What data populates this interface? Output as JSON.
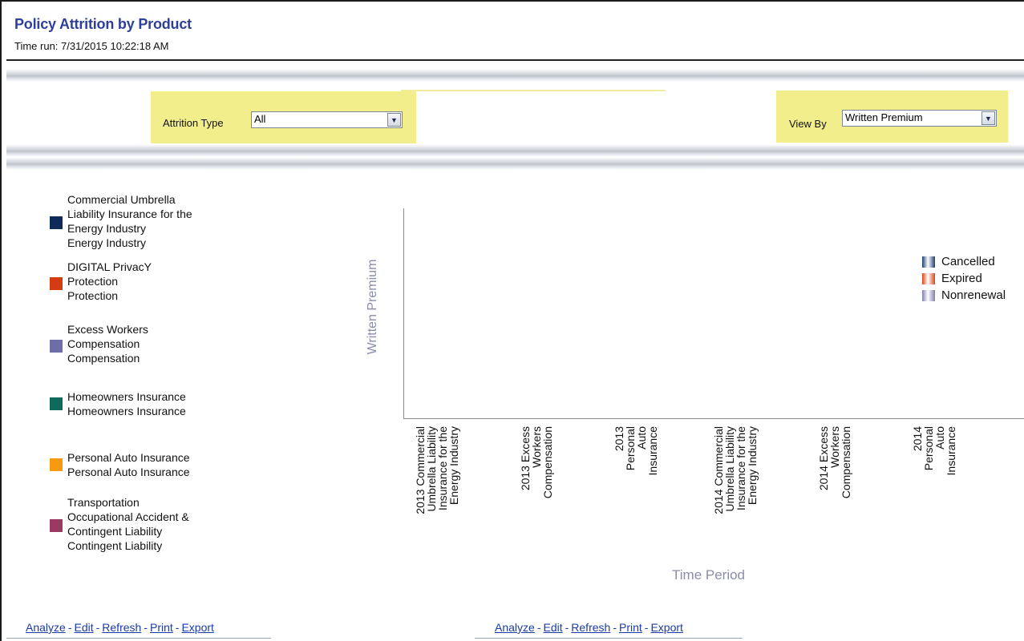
{
  "report": {
    "title": "Policy Attrition by Product",
    "time_run": "Time run: 7/31/2015 10:22:18 AM"
  },
  "prompts": {
    "attrition_type": {
      "label": "Attrition Type",
      "value": "All"
    },
    "view_by": {
      "label": "View By",
      "value": "Written Premium"
    }
  },
  "product_legend": [
    {
      "label_lines": [
        "Commercial Umbrella",
        "Liability Insurance for the",
        "Energy Industry",
        "Energy Industry"
      ],
      "color": "#0f2a5a"
    },
    {
      "label_lines": [
        "DIGITAL PrivacY",
        "Protection",
        "Protection"
      ],
      "color": "#d23c10"
    },
    {
      "label_lines": [
        "Excess Workers",
        "Compensation",
        "Compensation"
      ],
      "color": "#6e6ea6"
    },
    {
      "label_lines": [
        "Homeowners Insurance",
        "Homeowners Insurance"
      ],
      "color": "#0e6b5b"
    },
    {
      "label_lines": [
        "Personal Auto Insurance",
        "Personal Auto Insurance"
      ],
      "color": "#f79a10"
    },
    {
      "label_lines": [
        "Transportation",
        "Occupational Accident &",
        "Contingent Liability",
        "Contingent Liability"
      ],
      "color": "#9a3a62"
    }
  ],
  "chart_data": {
    "type": "bar",
    "xlabel": "Time Period",
    "ylabel": "Written Premium",
    "categories": [
      [
        "2013 Commercial",
        "Umbrella Liability",
        "Insurance for the",
        "Energy Industry"
      ],
      [
        "2013 Excess",
        "Workers",
        "Compensation"
      ],
      [
        "2013",
        "Personal",
        "Auto",
        "Insurance"
      ],
      [
        "2014 Commercial",
        "Umbrella Liability",
        "Insurance for the",
        "Energy Industry"
      ],
      [
        "2014 Excess",
        "Workers",
        "Compensation"
      ],
      [
        "2014",
        "Personal",
        "Auto",
        "Insurance"
      ]
    ],
    "series": [
      {
        "name": "Cancelled",
        "color": "#1f3f70",
        "values": []
      },
      {
        "name": "Expired",
        "color": "#d8461c",
        "values": []
      },
      {
        "name": "Nonrenewal",
        "color": "#8080b0",
        "values": []
      }
    ],
    "legend_position": "right"
  },
  "footer_links": {
    "analyze": "Analyze",
    "edit": "Edit",
    "refresh": "Refresh",
    "print": "Print",
    "export": "Export",
    "separator": "-"
  }
}
